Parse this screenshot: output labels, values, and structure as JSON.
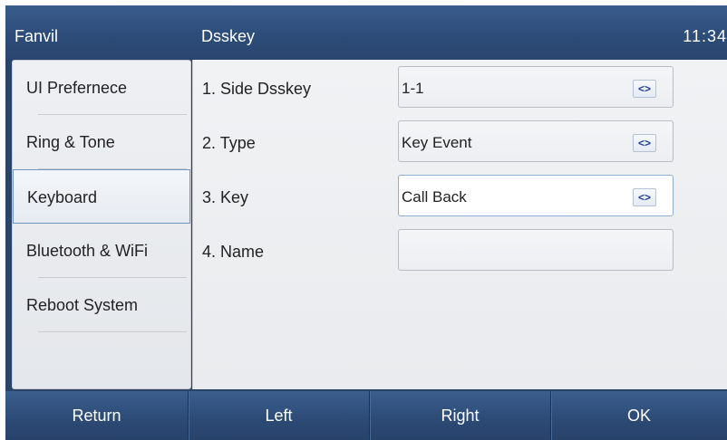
{
  "header": {
    "brand": "Fanvil",
    "title": "Dsskey",
    "time": "11:34"
  },
  "sidebar": {
    "items": [
      {
        "label": "UI Prefernece"
      },
      {
        "label": "Ring & Tone"
      },
      {
        "label": "Keyboard",
        "selected": true
      },
      {
        "label": "Bluetooth & WiFi"
      },
      {
        "label": "Reboot System"
      }
    ]
  },
  "main": {
    "rows": [
      {
        "label": "1. Side Dsskey",
        "value": "1-1",
        "has_arrows": true
      },
      {
        "label": "2. Type",
        "value": "Key Event",
        "has_arrows": true
      },
      {
        "label": "3. Key",
        "value": "Call Back",
        "has_arrows": true,
        "active": true
      },
      {
        "label": "4. Name",
        "value": "",
        "has_arrows": false
      }
    ],
    "arrow_glyph": "<>"
  },
  "softkeys": {
    "return_label": "Return",
    "left_label": "Left",
    "right_label": "Right",
    "ok_label": "OK"
  },
  "colors": {
    "header_bg": "#2d4c78",
    "panel_bg": "#eceef1",
    "selected_border": "#6f96c4",
    "arrow_color": "#1f3f8f"
  }
}
